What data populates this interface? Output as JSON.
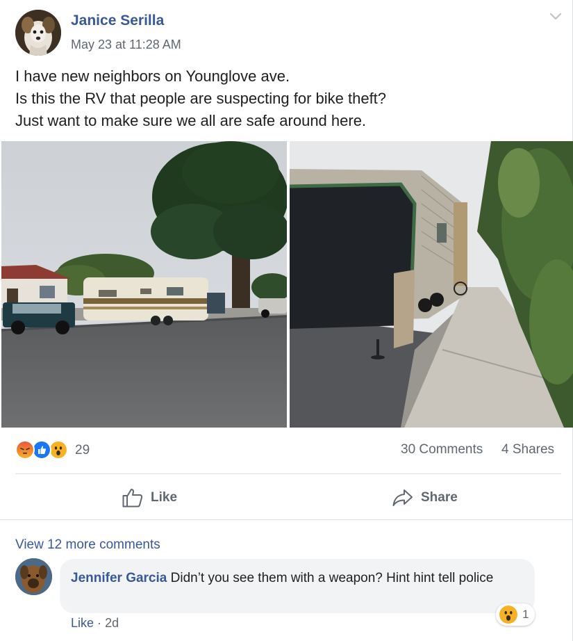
{
  "post": {
    "author": "Janice Serilla",
    "timestamp": "May 23 at 11:28 AM",
    "text_lines": [
      "I have new neighbors on Younglove ave.",
      "Is this the RV that people are suspecting for bike theft?",
      "Just want to make sure we all are safe around here."
    ],
    "reaction_icons": [
      "angry-reaction-icon",
      "like-reaction-icon",
      "wow-reaction-icon"
    ],
    "reaction_count": "29",
    "comments_count": "30 Comments",
    "shares_count": "4 Shares"
  },
  "actions": {
    "like_label": "Like",
    "share_label": "Share"
  },
  "comments": {
    "view_more": "View 12 more comments",
    "items": [
      {
        "author": "Jennifer Garcia",
        "text": "Didn’t you see them with a weapon? Hint hint tell police",
        "like_label": "Like",
        "separator": "·",
        "age": "2d",
        "reaction_icon": "wow-reaction-icon",
        "reaction_count": "1"
      }
    ]
  },
  "colors": {
    "link_blue": "#385898",
    "meta_gray": "#606770",
    "bubble_gray": "#f2f3f5",
    "like_blue": "#1877f2",
    "angry_orange": "#e9710f",
    "wow_yellow": "#f7b125"
  }
}
